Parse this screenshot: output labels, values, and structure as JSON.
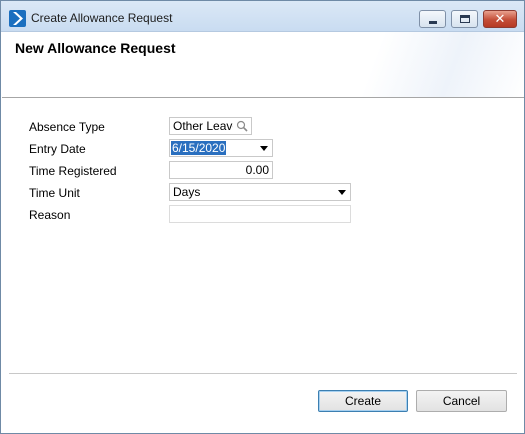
{
  "window": {
    "title": "Create Allowance Request",
    "close_symbol": "✕"
  },
  "header": {
    "title": "New Allowance Request"
  },
  "form": {
    "absence_type": {
      "label": "Absence Type",
      "value": "Other Leave"
    },
    "entry_date": {
      "label": "Entry Date",
      "value": "6/15/2020"
    },
    "time_registered": {
      "label": "Time Registered",
      "value": "0.00"
    },
    "time_unit": {
      "label": "Time Unit",
      "value": "Days"
    },
    "reason": {
      "label": "Reason",
      "value": ""
    }
  },
  "buttons": {
    "create": "Create",
    "cancel": "Cancel"
  },
  "icons": {
    "app": "app-logo-icon",
    "search": "search-icon",
    "dropdown": "chevron-down-icon"
  },
  "colors": {
    "titlebar": "#c9dcf1",
    "selection": "#2a6fbf",
    "close_button": "#c44e38",
    "primary_button_border": "#3c7fb1"
  }
}
